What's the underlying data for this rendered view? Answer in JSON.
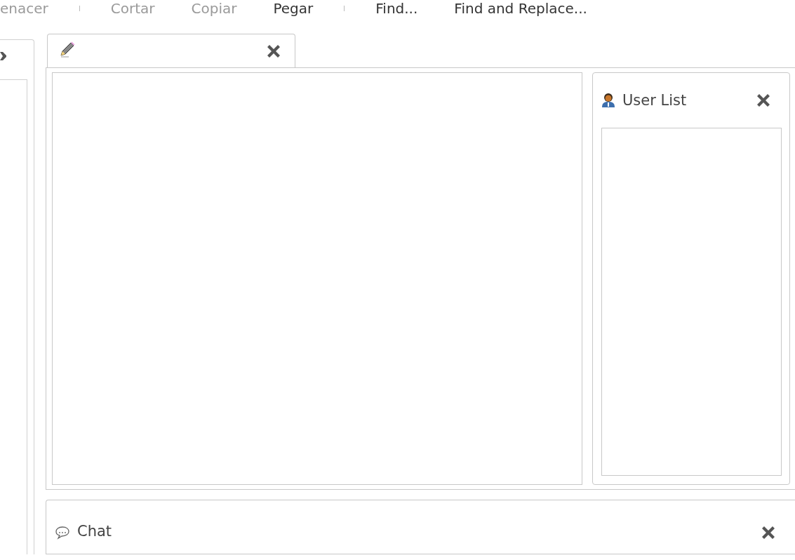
{
  "toolbar": {
    "items": [
      {
        "kind": "button",
        "label": "enacer",
        "disabled": true
      },
      {
        "kind": "separator"
      },
      {
        "kind": "button",
        "label": "Cortar",
        "disabled": true
      },
      {
        "kind": "button",
        "label": "Copiar",
        "disabled": true
      },
      {
        "kind": "button",
        "label": "Pegar",
        "disabled": false
      },
      {
        "kind": "separator"
      },
      {
        "kind": "button",
        "label": "Find...",
        "disabled": false
      },
      {
        "kind": "button",
        "label": "Find and Replace...",
        "disabled": false
      }
    ]
  },
  "editor_tabs": [
    {
      "selected": true
    }
  ],
  "user_list": {
    "title": "User List"
  },
  "chat": {
    "title": "Chat"
  }
}
